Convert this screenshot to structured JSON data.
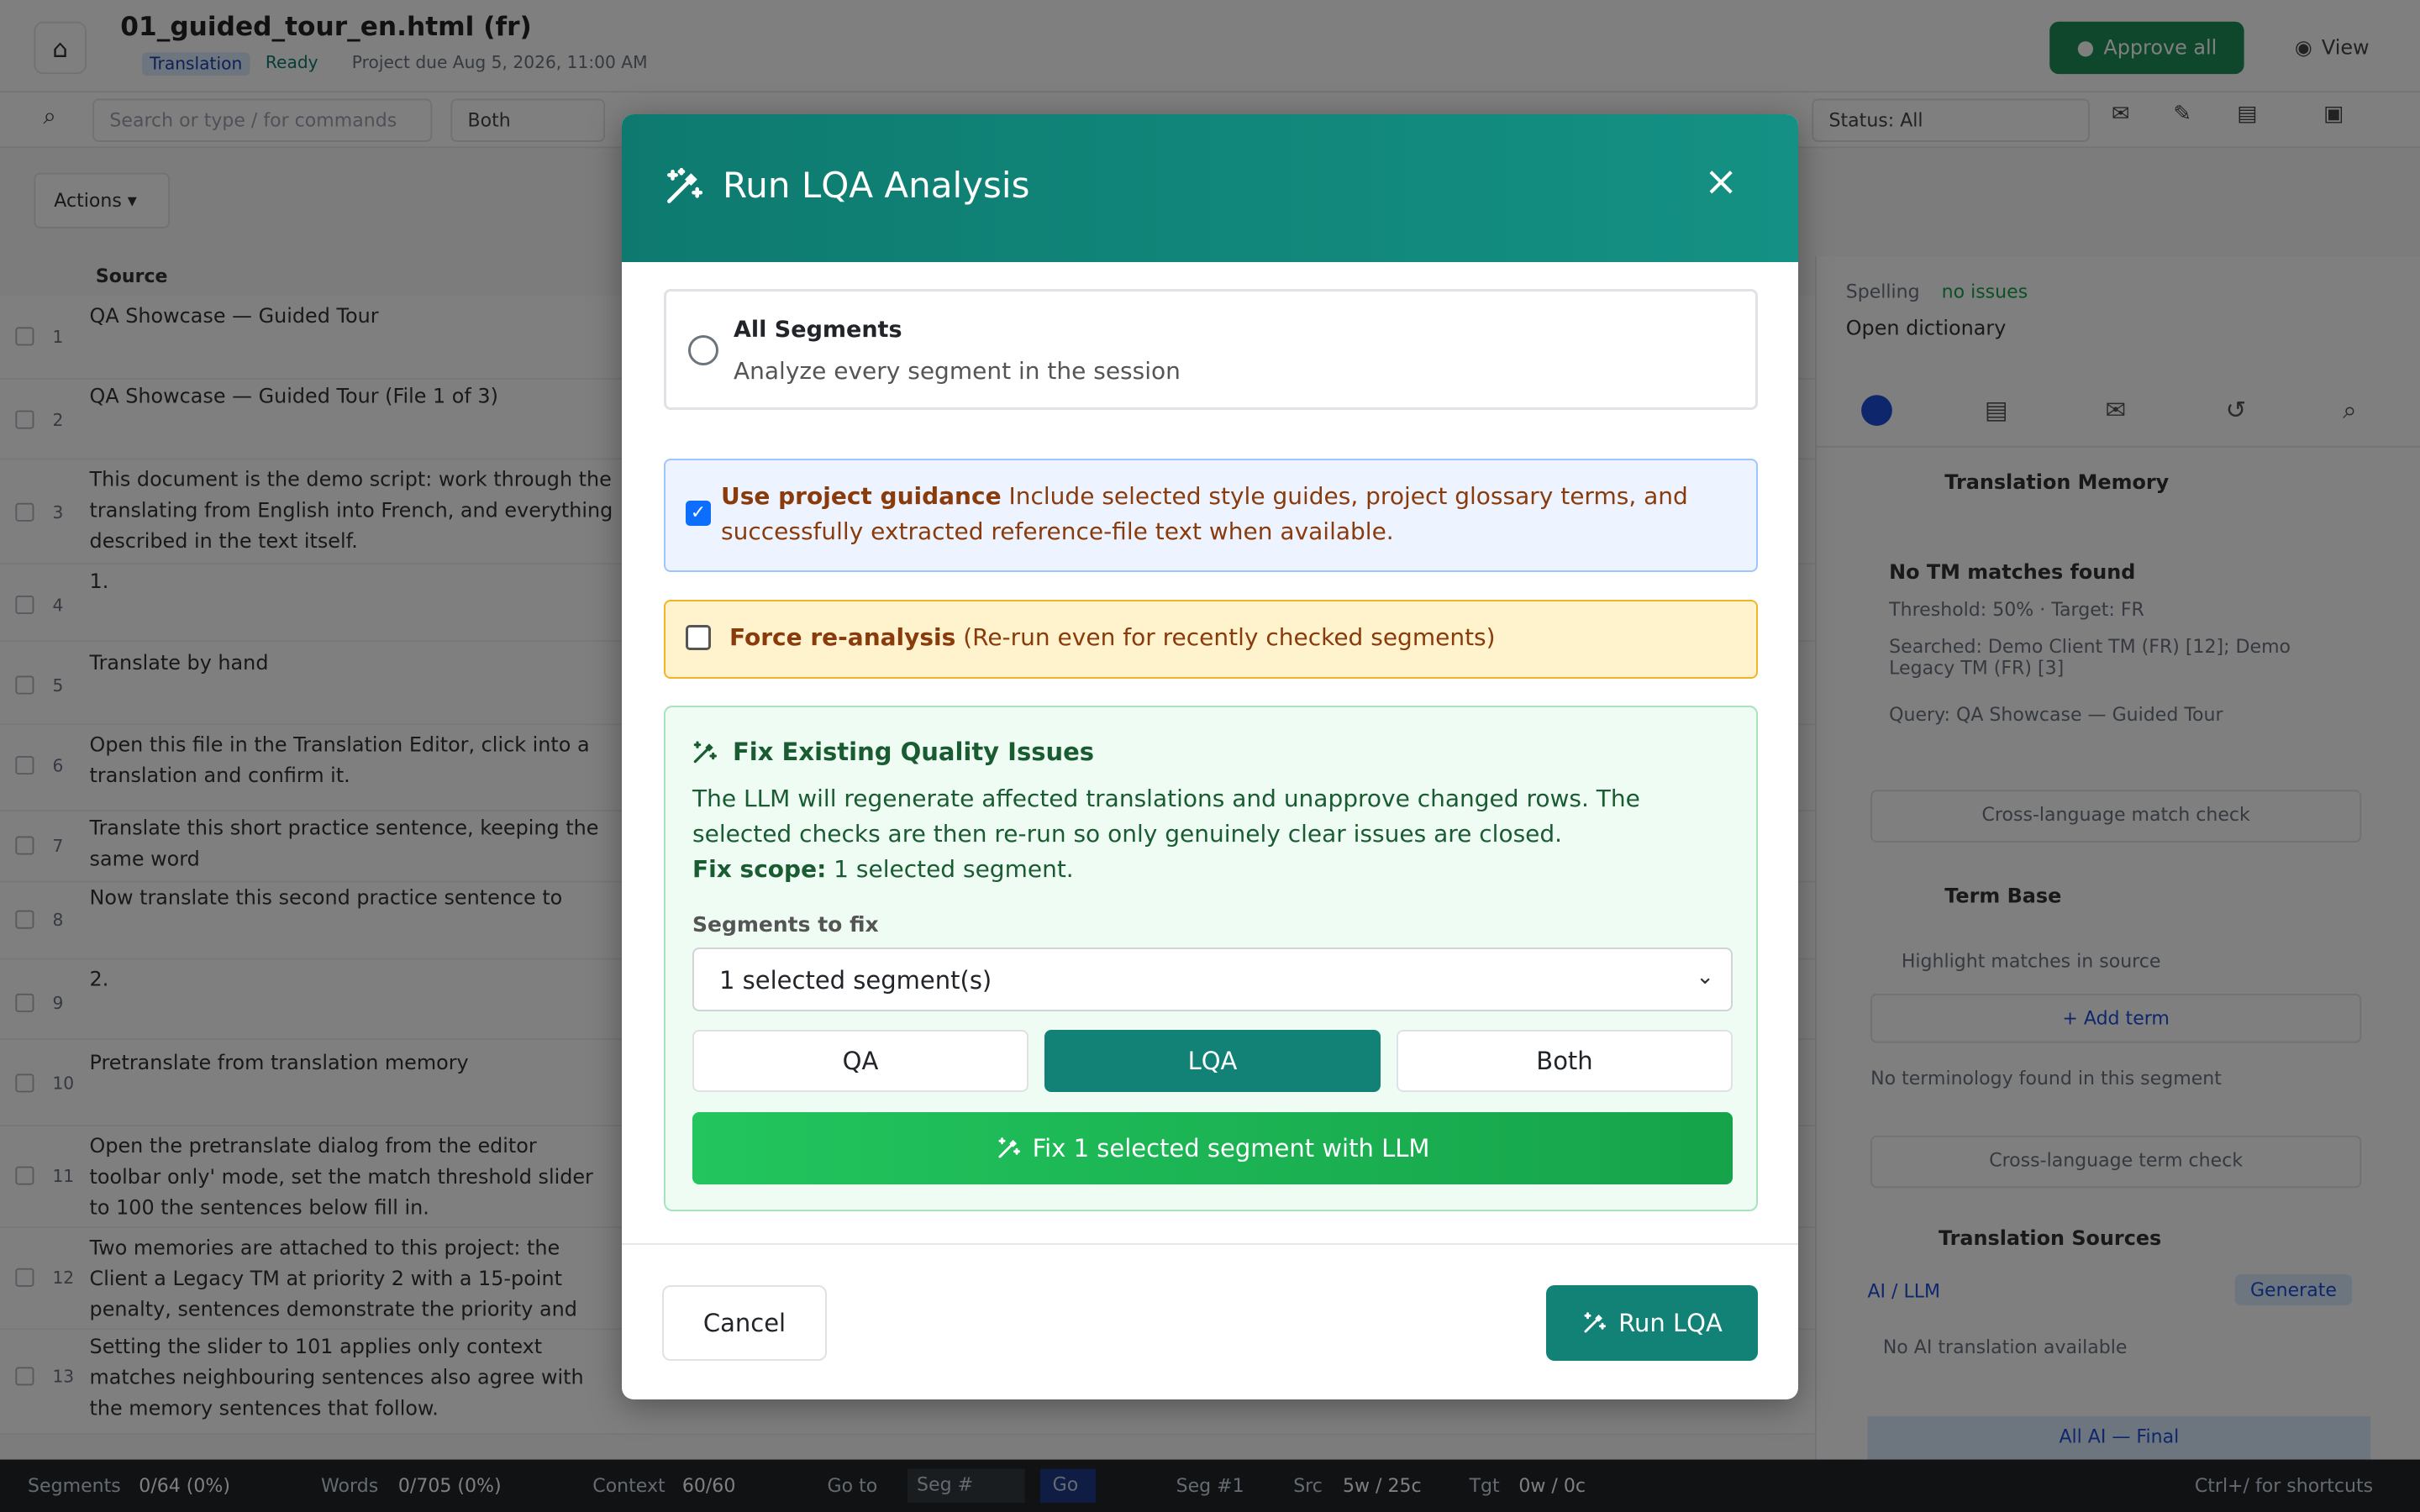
{
  "background": {
    "file_title": "01_guided_tour_en.html (fr)",
    "tag_translation": "Translation",
    "tag_ready": "Ready",
    "due_date": "Project due Aug 5, 2026, 11:00 AM",
    "approve_all": "Approve all",
    "view": "View",
    "search_placeholder": "Search or type / for commands",
    "filter_both": "Both",
    "status_filter": "Status: All",
    "actions": "Actions ▾",
    "source_header": "Source",
    "segments": [
      {
        "n": "1",
        "text": "QA Showcase — Guided Tour"
      },
      {
        "n": "2",
        "text": "QA Showcase — Guided Tour (File 1 of 3)"
      },
      {
        "n": "3",
        "text": "This document is the demo script: work through the translating from English into French, and everything described in the text itself."
      },
      {
        "n": "4",
        "text": "1."
      },
      {
        "n": "5",
        "text": "Translate by hand"
      },
      {
        "n": "6",
        "text": "Open this file in the Translation Editor, click into a translation and confirm it."
      },
      {
        "n": "7",
        "text": "Translate this short practice sentence, keeping the same word"
      },
      {
        "n": "8",
        "text": "Now translate this second practice sentence to"
      },
      {
        "n": "9",
        "text": "2."
      },
      {
        "n": "10",
        "text": "Pretranslate from translation memory"
      },
      {
        "n": "11",
        "text": "Open the pretranslate dialog from the editor toolbar only' mode, set the match threshold slider to 100 the sentences below fill in."
      },
      {
        "n": "12",
        "text": "Two memories are attached to this project: the Client a Legacy TM at priority 2 with a 15-point penalty, sentences demonstrate the priority and penalty"
      },
      {
        "n": "13",
        "text": "Setting the slider to 101 applies only context matches neighbouring sentences also agree with the memory sentences that follow."
      }
    ],
    "right_panel": {
      "spelling_label": "Spelling",
      "spelling_status": "no issues",
      "open_dictionary": "Open dictionary",
      "tm_title": "Translation Memory",
      "tm_none": "No TM matches found",
      "tm_threshold": "Threshold: 50% · Target: FR",
      "tm_searched": "Searched: Demo Client TM (FR) [12]; Demo Legacy TM (FR) [3]",
      "tm_query": "Query: QA Showcase — Guided Tour",
      "cross_match": "Cross-language match check",
      "tb_title": "Term Base",
      "tb_highlight": "Highlight matches in source",
      "tb_add": "+ Add term",
      "tb_none": "No terminology found in this segment",
      "cross_term": "Cross-language term check",
      "ts_title": "Translation Sources",
      "ts_ai": "AI / LLM",
      "ts_generate": "Generate",
      "ts_none": "No AI translation available",
      "ts_final": "All AI — Final"
    },
    "status_bar": {
      "segments_label": "Segments",
      "segments_value": "0/64 (0%)",
      "words_label": "Words",
      "words_value": "0/705 (0%)",
      "context_label": "Context",
      "context_value": "60/60",
      "go_label": "Go to",
      "go_placeholder": "Seg #",
      "go_button": "Go",
      "seg_label": "Seg #1",
      "src_label": "Src",
      "src_value": "5w / 25c",
      "tgt_label": "Tgt",
      "tgt_value": "0w / 0c",
      "shortcuts": "Ctrl+/ for shortcuts"
    }
  },
  "modal": {
    "title": "Run LQA Analysis",
    "close": "×",
    "all_segments": {
      "title": "All Segments",
      "desc": "Analyze every segment in the session",
      "selected": false
    },
    "guidance": {
      "label": "Use project guidance",
      "desc": "Include selected style guides, project glossary terms, and successfully extracted reference-file text when available.",
      "checked": true
    },
    "force": {
      "label": "Force re-analysis",
      "desc": "(Re-run even for recently checked segments)",
      "checked": false
    },
    "fix": {
      "title": "Fix Existing Quality Issues",
      "desc": "The LLM will regenerate affected translations and unapprove changed rows. The selected checks are then re-run so only genuinely clear issues are closed.",
      "scope_label": "Fix scope:",
      "scope_value": "1 selected segment.",
      "segments_label": "Segments to fix",
      "segments_value": "1 selected segment(s)",
      "toggle_options": [
        "QA",
        "LQA",
        "Both"
      ],
      "toggle_active": "LQA",
      "fix_button": "Fix 1 selected segment with LLM"
    },
    "cancel": "Cancel",
    "run": "Run LQA"
  },
  "colors": {
    "header_teal": "#0e7a6f",
    "fix_green": "#22c55e",
    "guidance_blue_bg": "#eef4ff",
    "force_yellow_bg": "#fff3cd",
    "guidance_text": "#8a3b0c",
    "fix_text": "#1a5c32"
  },
  "icons": [
    "magic-wand-icon",
    "close-icon",
    "home-icon",
    "search-icon",
    "chevron-down-icon",
    "eye-icon",
    "lock-icon",
    "comment-icon"
  ]
}
